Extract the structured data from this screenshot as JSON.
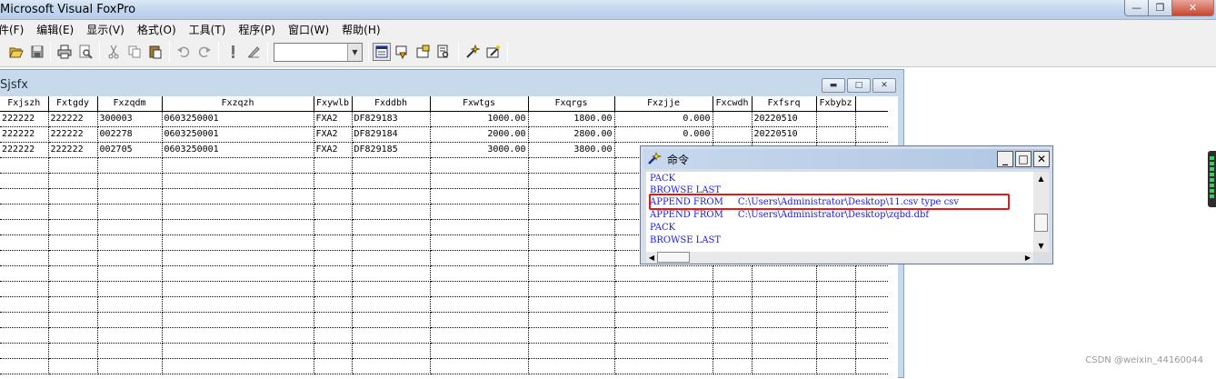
{
  "app": {
    "title": "Microsoft Visual FoxPro"
  },
  "menu": [
    "文件(F)",
    "编辑(E)",
    "显示(V)",
    "格式(O)",
    "工具(T)",
    "程序(P)",
    "窗口(W)",
    "帮助(H)"
  ],
  "toolbar": {
    "combo_value": "",
    "icons": [
      "open-icon",
      "save-icon",
      "print-icon",
      "print-preview-icon",
      "cut-icon",
      "copy-icon",
      "paste-icon",
      "undo-icon",
      "redo-icon",
      "run-icon",
      "modify-form-icon",
      "browse-window-icon",
      "database-icon",
      "properties-icon",
      "code-window-icon",
      "form-wizard-icon",
      "builder-icon"
    ]
  },
  "browse": {
    "title": "Sjsfx",
    "columns": [
      "Fxjszh",
      "Fxtgdy",
      "Fxzqdm",
      "Fxzqzh",
      "Fxywlb",
      "Fxddbh",
      "Fxwtgs",
      "Fxqrgs",
      "Fxzjje",
      "Fxcwdh",
      "Fxfsrq",
      "Fxbybz"
    ],
    "rows": [
      [
        "222222",
        "222222",
        "300003",
        "0603250001",
        "FXA2",
        "DF829183",
        "1000.00",
        "1800.00",
        "0.000",
        "",
        "20220510",
        ""
      ],
      [
        "222222",
        "222222",
        "002278",
        "0603250001",
        "FXA2",
        "DF829184",
        "2000.00",
        "2800.00",
        "0.000",
        "",
        "20220510",
        ""
      ],
      [
        "222222",
        "222222",
        "002705",
        "0603250001",
        "FXA2",
        "DF829185",
        "3000.00",
        "3800.00",
        "",
        "",
        "",
        ""
      ]
    ]
  },
  "command_window": {
    "title": "命令",
    "lines": [
      {
        "cmd": "PACK",
        "arg": ""
      },
      {
        "cmd": "BROWSE LAST",
        "arg": ""
      },
      {
        "cmd": "APPEND FROM",
        "arg": "C:\\Users\\Administrator\\Desktop\\11.csv type csv"
      },
      {
        "cmd": "APPEND FROM",
        "arg": "C:\\Users\\Administrator\\Desktop\\zqbd.dbf"
      },
      {
        "cmd": "PACK",
        "arg": ""
      },
      {
        "cmd": "BROWSE LAST",
        "arg": ""
      }
    ],
    "highlight_color": "#e0191d",
    "text_color": "#1a1ae0"
  },
  "watermark": "CSDN @weixin_44160044"
}
